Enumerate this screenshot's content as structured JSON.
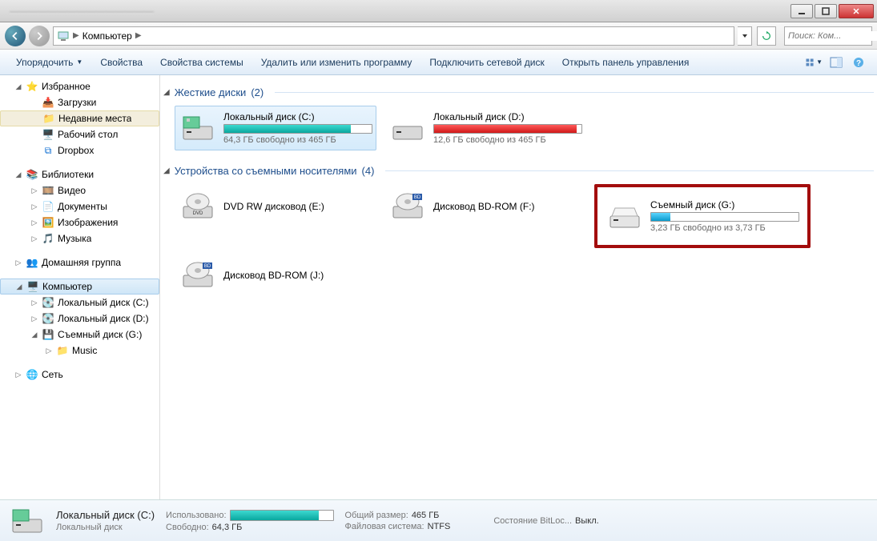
{
  "titlebar": {
    "blurred_title": "———————————————"
  },
  "nav": {
    "breadcrumb_label": "Компьютер",
    "search_placeholder": "Поиск: Ком..."
  },
  "toolbar": {
    "organize": "Упорядочить",
    "properties": "Свойства",
    "sys_props": "Свойства системы",
    "uninstall": "Удалить или изменить программу",
    "map_drive": "Подключить сетевой диск",
    "control_panel": "Открыть панель управления"
  },
  "sidebar": {
    "favorites": "Избранное",
    "downloads": "Загрузки",
    "recent": "Недавние места",
    "desktop": "Рабочий стол",
    "dropbox": "Dropbox",
    "libraries": "Библиотеки",
    "videos": "Видео",
    "documents": "Документы",
    "pictures": "Изображения",
    "music": "Музыка",
    "homegroup": "Домашняя группа",
    "computer": "Компьютер",
    "drive_c": "Локальный диск (C:)",
    "drive_d": "Локальный диск (D:)",
    "drive_g": "Съемный диск (G:)",
    "music_folder": "Music",
    "network": "Сеть"
  },
  "groups": {
    "hard_drives_label": "Жесткие диски",
    "hard_drives_count": "(2)",
    "removable_label": "Устройства со съемными носителями",
    "removable_count": "(4)"
  },
  "drives": {
    "c": {
      "name": "Локальный диск (C:)",
      "free": "64,3 ГБ свободно из 465 ГБ",
      "fill_pct": 86,
      "color": "teal"
    },
    "d": {
      "name": "Локальный диск (D:)",
      "free": "12,6 ГБ свободно из 465 ГБ",
      "fill_pct": 97,
      "color": "red"
    },
    "e": {
      "name": "DVD RW дисковод (E:)"
    },
    "f": {
      "name": "Дисковод BD-ROM (F:)"
    },
    "j": {
      "name": "Дисковод BD-ROM (J:)"
    },
    "g": {
      "name": "Съемный диск (G:)",
      "free": "3,23 ГБ свободно из 3,73 ГБ",
      "fill_pct": 13,
      "color": "blue"
    }
  },
  "details": {
    "title": "Локальный диск (C:)",
    "subtitle": "Локальный диск",
    "used_label": "Использовано:",
    "free_label": "Свободно:",
    "free_val": "64,3 ГБ",
    "total_label": "Общий размер:",
    "total_val": "465 ГБ",
    "fs_label": "Файловая система:",
    "fs_val": "NTFS",
    "bitlocker_label": "Состояние BitLoc...",
    "bitlocker_val": "Выкл.",
    "bar_pct": 86
  }
}
